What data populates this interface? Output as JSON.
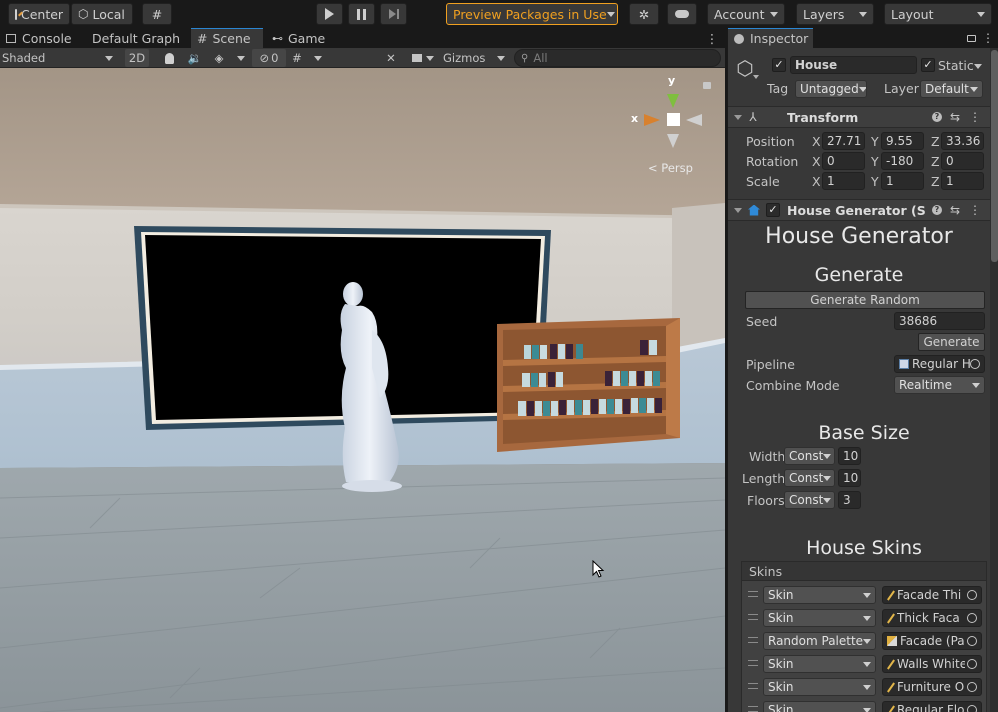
{
  "toolbar": {
    "pivot": "Center",
    "space": "Local",
    "preview_packages": "Preview Packages in Use",
    "account": "Account",
    "layers": "Layers",
    "layout": "Layout"
  },
  "scene_tabs": [
    {
      "label": "Console"
    },
    {
      "label": "Default Graph"
    },
    {
      "label": "Scene"
    },
    {
      "label": "Game"
    }
  ],
  "scene_toolbar": {
    "draw_mode": "Shaded",
    "mode_2d": "2D",
    "hidden_count": "0",
    "gizmos": "Gizmos",
    "search_placeholder": "All"
  },
  "scene_view": {
    "axis_y": "y",
    "axis_x": "x",
    "projection": "< Persp"
  },
  "inspector": {
    "tab_label": "Inspector",
    "object_name": "House",
    "static_label": "Static",
    "tag_label": "Tag",
    "tag_value": "Untagged",
    "layer_label": "Layer",
    "layer_value": "Default",
    "transform": {
      "title": "Transform",
      "position_label": "Position",
      "rotation_label": "Rotation",
      "scale_label": "Scale",
      "axis": {
        "x": "X",
        "y": "Y",
        "z": "Z"
      },
      "position": {
        "x": "27.71",
        "y": "9.55",
        "z": "33.36"
      },
      "rotation": {
        "x": "0",
        "y": "-180",
        "z": "0"
      },
      "scale": {
        "x": "1",
        "y": "1",
        "z": "1"
      }
    },
    "house_generator": {
      "component_title": "House Generator (Scrip",
      "heading": "House Generator",
      "generate_heading": "Generate",
      "generate_random": "Generate Random",
      "seed_label": "Seed",
      "seed_value": "38686",
      "generate_button": "Generate",
      "pipeline_label": "Pipeline",
      "pipeline_value": "Regular H",
      "combine_label": "Combine Mode",
      "combine_value": "Realtime",
      "base_size_heading": "Base Size",
      "width_label": "Width",
      "width_mode": "Const",
      "width_value": "10",
      "length_label": "Length",
      "length_mode": "Const",
      "length_value": "10",
      "floors_label": "Floors",
      "floors_mode": "Const",
      "floors_value": "3",
      "skins_heading": "House Skins",
      "skins_list_label": "Skins",
      "skins": [
        {
          "type": "Skin",
          "asset": "Facade Thi"
        },
        {
          "type": "Skin",
          "asset": "Thick Faca"
        },
        {
          "type": "Random Palette",
          "asset": "Facade (Pa"
        },
        {
          "type": "Skin",
          "asset": "Walls White"
        },
        {
          "type": "Skin",
          "asset": "Furniture Oı"
        },
        {
          "type": "Skin",
          "asset": "Regular Flo"
        }
      ]
    }
  },
  "colors": {
    "accent_blue": "#2b86d2",
    "preview_orange": "#f0a020",
    "panel": "#383838",
    "toolbar": "#191919"
  }
}
